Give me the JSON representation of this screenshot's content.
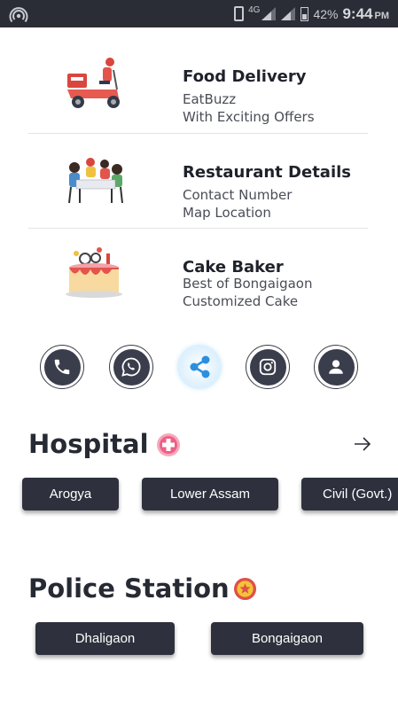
{
  "status_bar": {
    "network_label": "4G",
    "battery": "42%",
    "time": "9:44",
    "ampm": "PM"
  },
  "services": [
    {
      "title": "Food Delivery",
      "line1": "EatBuzz",
      "line2": "With Exciting Offers",
      "illustration": "delivery-scooter-icon"
    },
    {
      "title": "Restaurant Details",
      "line1": "Contact Number",
      "line2": "Map Location",
      "illustration": "dining-people-icon"
    },
    {
      "title": "Cake Baker",
      "line1": "Best of Bongaigaon",
      "line2": "Customized Cake",
      "illustration": "cake-icon"
    }
  ],
  "social": [
    "phone-icon",
    "whatsapp-icon",
    "share-icon",
    "instagram-icon",
    "profile-icon"
  ],
  "hospital": {
    "title": "Hospital",
    "icon": "medical-cross-icon",
    "arrow": "arrow-right-icon",
    "chips": [
      "Arogya",
      "Lower Assam",
      "Civil (Govt.)"
    ]
  },
  "police": {
    "title": "Police Station",
    "icon": "police-badge-icon",
    "chips": [
      "Dhaligaon",
      "Bongaigaon"
    ]
  },
  "colors": {
    "chip_bg": "#2e313d",
    "status_bar": "#2a2d35",
    "accent_red": "#e0504a",
    "hospital_icon": "#f06c8e"
  }
}
